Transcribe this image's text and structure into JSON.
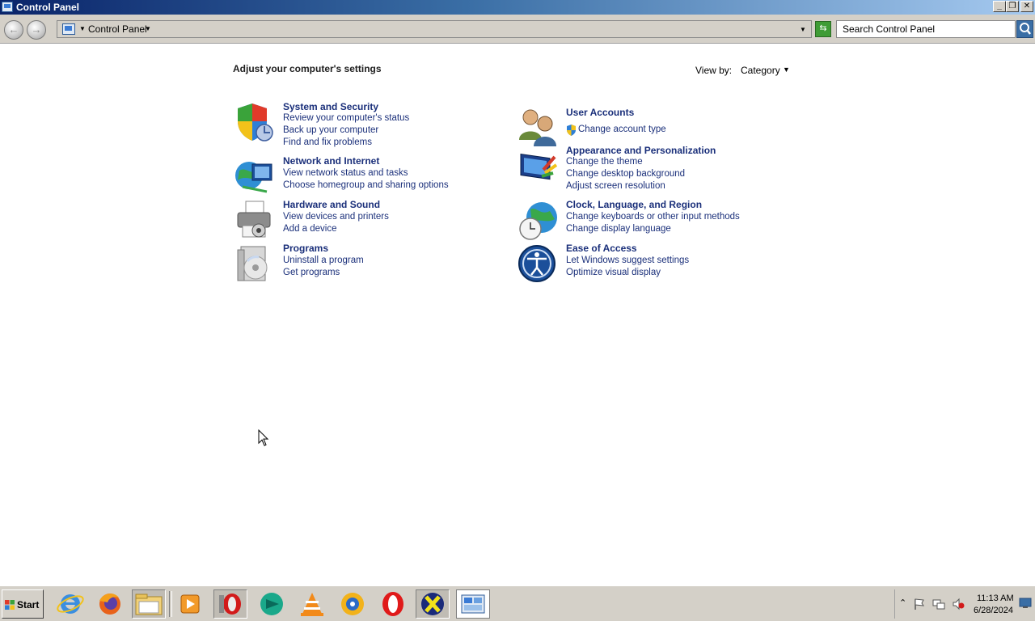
{
  "window": {
    "title": "Control Panel",
    "controls": {
      "minimize": "_",
      "restore": "❐",
      "close": "✕"
    }
  },
  "address_bar": {
    "back_icon": "back-arrow-icon",
    "forward_icon": "forward-arrow-icon",
    "breadcrumb": "Control Panel",
    "search_placeholder": "Search Control Panel"
  },
  "content": {
    "heading": "Adjust your computer's settings",
    "view_by_label": "View by:",
    "view_by_value": "Category",
    "categories_left": [
      {
        "title": "System and Security",
        "links": [
          "Review your computer's status",
          "Back up your computer",
          "Find and fix problems"
        ],
        "icon": "shield-icon"
      },
      {
        "title": "Network and Internet",
        "links": [
          "View network status and tasks",
          "Choose homegroup and sharing options"
        ],
        "icon": "network-globe-icon"
      },
      {
        "title": "Hardware and Sound",
        "links": [
          "View devices and printers",
          "Add a device"
        ],
        "icon": "printer-icon"
      },
      {
        "title": "Programs",
        "links": [
          "Uninstall a program",
          "Get programs"
        ],
        "icon": "programs-disc-icon"
      }
    ],
    "categories_right": [
      {
        "title": "User Accounts",
        "links": [
          "Change account type"
        ],
        "icon": "users-icon"
      },
      {
        "title": "Appearance and Personalization",
        "links": [
          "Change the theme",
          "Change desktop background",
          "Adjust screen resolution"
        ],
        "icon": "monitor-paint-icon"
      },
      {
        "title": "Clock, Language, and Region",
        "links": [
          "Change keyboards or other input methods",
          "Change display language"
        ],
        "icon": "clock-globe-icon"
      },
      {
        "title": "Ease of Access",
        "links": [
          "Let Windows suggest settings",
          "Optimize visual display"
        ],
        "icon": "ease-of-access-icon"
      }
    ]
  },
  "taskbar": {
    "start_label": "Start",
    "apps": [
      "internet-explorer-icon",
      "firefox-icon",
      "file-explorer-icon",
      "media-player-icon",
      "opera-installer-icon",
      "messenger-icon",
      "vlc-icon",
      "settings-gear-icon",
      "opera-icon",
      "xbox-icon",
      "control-panel-icon"
    ],
    "clock_time": "11:13 AM",
    "clock_date": "6/28/2024"
  },
  "colors": {
    "link": "#1a2f7a",
    "titlebar_start": "#0a246a",
    "titlebar_end": "#a6caf0",
    "chrome": "#d4d0c8"
  }
}
